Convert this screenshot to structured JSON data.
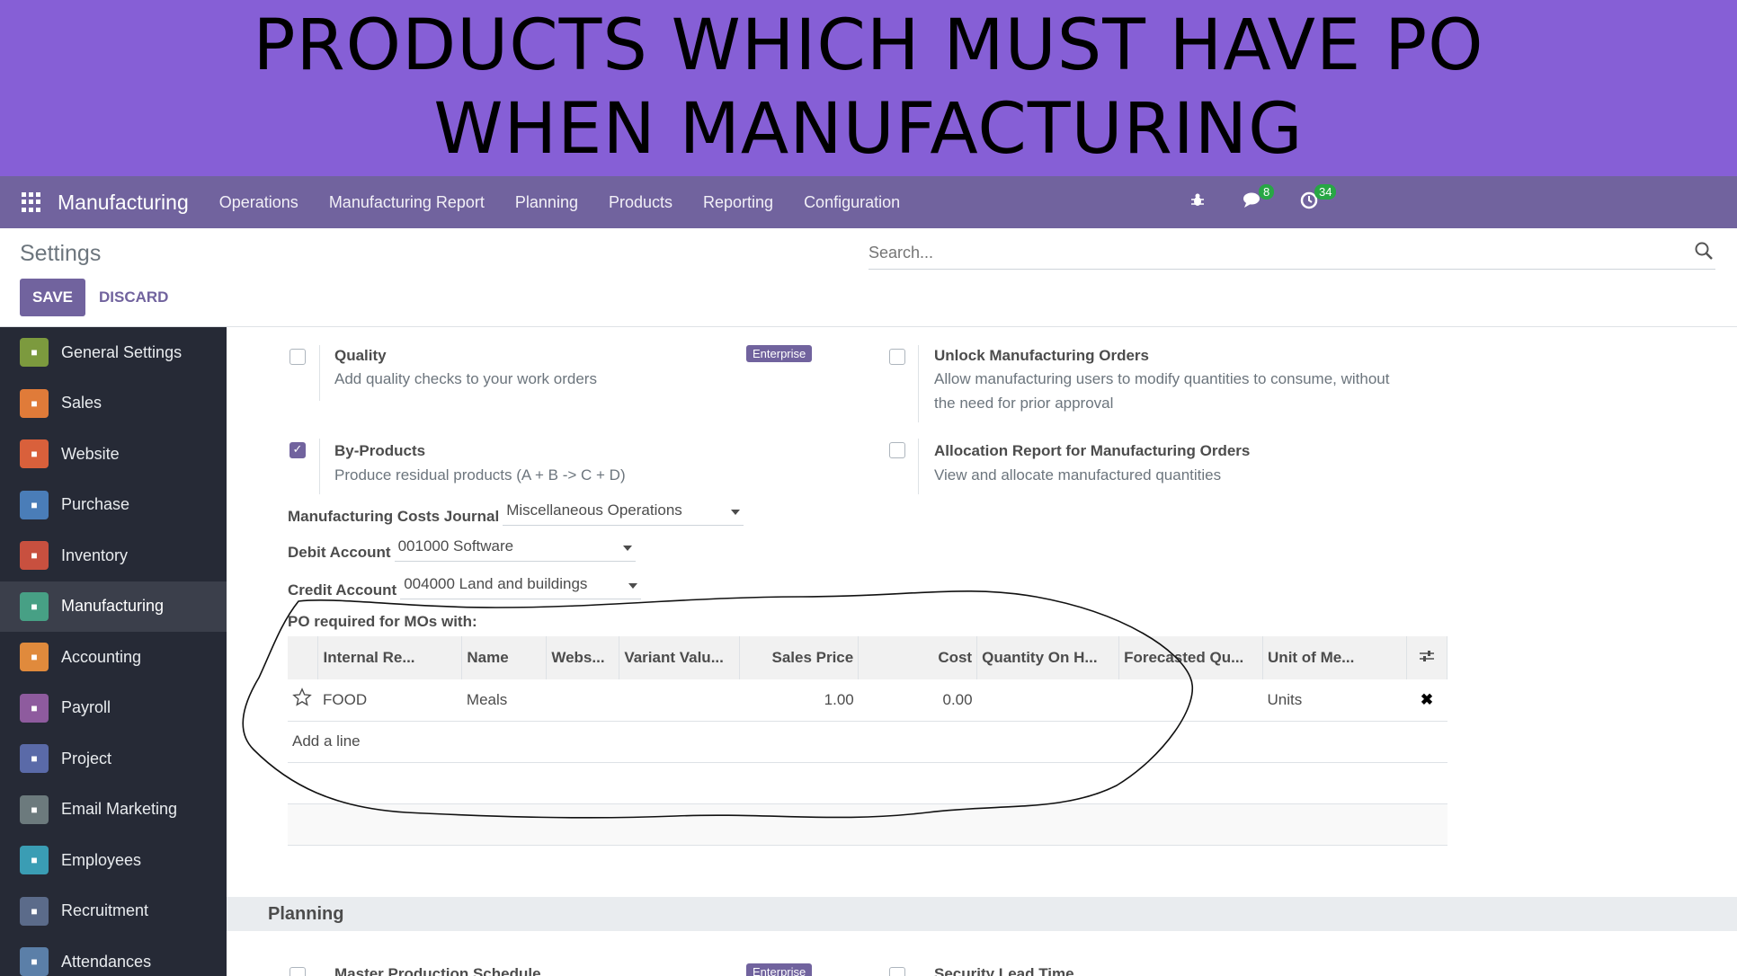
{
  "banner": {
    "title": "PRODUCTS WHICH MUST HAVE PO WHEN MANUFACTURING"
  },
  "navbar": {
    "brand": "Manufacturing",
    "menu": [
      "Operations",
      "Manufacturing Report",
      "Planning",
      "Products",
      "Reporting",
      "Configuration"
    ],
    "messages_count": "8",
    "activities_count": "34"
  },
  "control": {
    "breadcrumb": "Settings",
    "save_label": "SAVE",
    "discard_label": "DISCARD",
    "search_placeholder": "Search..."
  },
  "sidebar": {
    "items": [
      {
        "label": "General Settings",
        "icon": "gear-icon",
        "color": "#7c9a3e"
      },
      {
        "label": "Sales",
        "icon": "chart-icon",
        "color": "#e07b39"
      },
      {
        "label": "Website",
        "icon": "globe-icon",
        "color": "#d9603b"
      },
      {
        "label": "Purchase",
        "icon": "credit-card-icon",
        "color": "#4a7db8"
      },
      {
        "label": "Inventory",
        "icon": "box-icon",
        "color": "#c8503f"
      },
      {
        "label": "Manufacturing",
        "icon": "wrench-icon",
        "color": "#47a085"
      },
      {
        "label": "Accounting",
        "icon": "invoice-icon",
        "color": "#e08a3c"
      },
      {
        "label": "Payroll",
        "icon": "payroll-icon",
        "color": "#8e5b9e"
      },
      {
        "label": "Project",
        "icon": "puzzle-icon",
        "color": "#5a6aa8"
      },
      {
        "label": "Email Marketing",
        "icon": "paper-plane-icon",
        "color": "#6c7a7d"
      },
      {
        "label": "Employees",
        "icon": "users-icon",
        "color": "#3a9db4"
      },
      {
        "label": "Recruitment",
        "icon": "magnifier-icon",
        "color": "#5b6b8a"
      },
      {
        "label": "Attendances",
        "icon": "user-clock-icon",
        "color": "#5b7fa8"
      }
    ]
  },
  "settings": {
    "quality": {
      "title": "Quality",
      "desc": "Add quality checks to your work orders",
      "badge": "Enterprise",
      "checked": false
    },
    "unlock_mo": {
      "title": "Unlock Manufacturing Orders",
      "desc": "Allow manufacturing users to modify quantities to consume, without the need for prior approval",
      "checked": false
    },
    "by_products": {
      "title": "By-Products",
      "desc": "Produce residual products (A + B -> C + D)",
      "checked": true
    },
    "allocation": {
      "title": "Allocation Report for Manufacturing Orders",
      "desc": "View and allocate manufactured quantities",
      "checked": false
    },
    "costs_journal": {
      "label": "Manufacturing Costs Journal",
      "value": "Miscellaneous Operations"
    },
    "debit_account": {
      "label": "Debit Account",
      "value": "001000 Software"
    },
    "credit_account": {
      "label": "Credit Account",
      "value": "004000 Land and buildings"
    },
    "po_required_label": "PO required for MOs with:",
    "table": {
      "columns": [
        "Internal Re...",
        "Name",
        "Webs...",
        "Variant Valu...",
        "Sales Price",
        "Cost",
        "Quantity On H...",
        "Forecasted Qu...",
        "Unit of Me..."
      ],
      "rows": [
        {
          "internal_ref": "FOOD",
          "name": "Meals",
          "website": "",
          "variant": "",
          "sales_price": "1.00",
          "cost": "0.00",
          "qty_on_hand": "",
          "forecasted": "",
          "uom": "Units"
        }
      ],
      "add_line": "Add a line"
    },
    "planning_section": "Planning",
    "mps": {
      "title": "Master Production Schedule",
      "badge": "Enterprise"
    },
    "security_lead": {
      "title": "Security Lead Time"
    }
  }
}
